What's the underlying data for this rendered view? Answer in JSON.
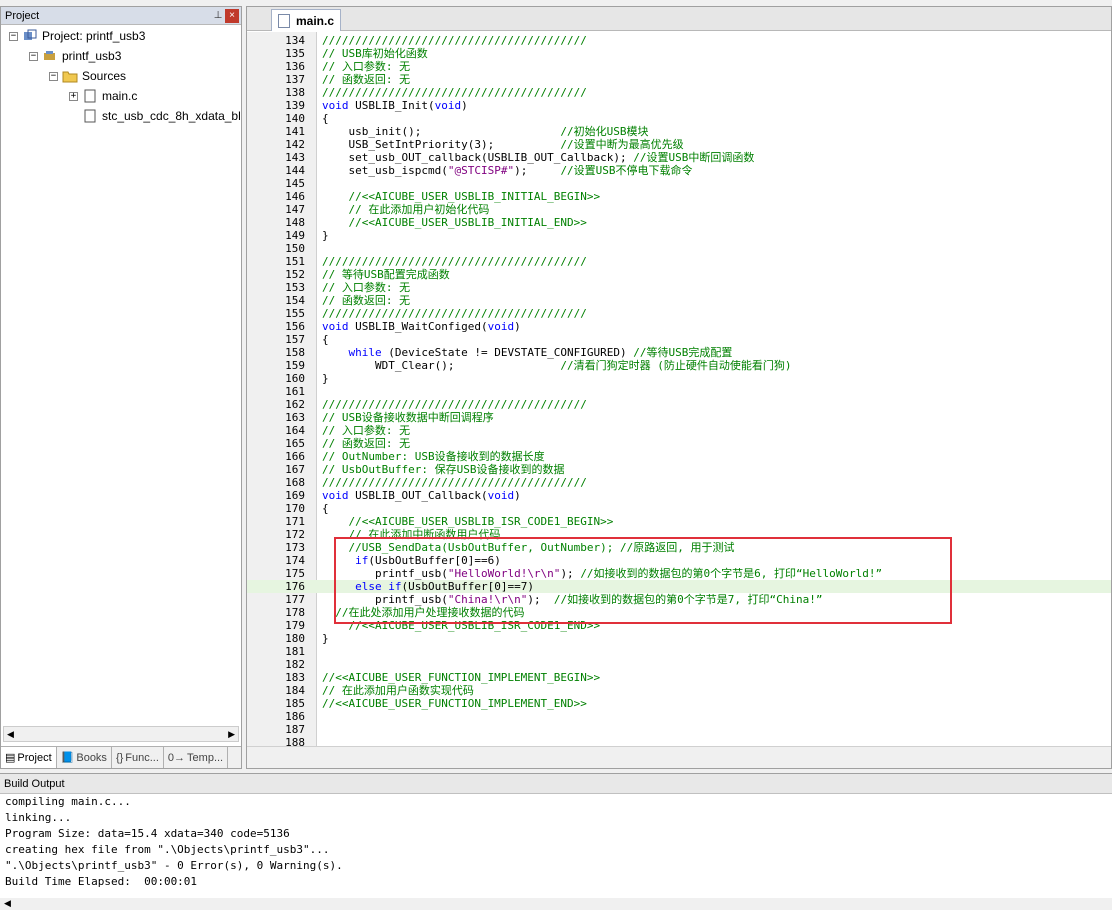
{
  "project": {
    "title": "Project",
    "pin": "⊥",
    "close": "×",
    "tree": {
      "root": "Project: printf_usb3",
      "target": "printf_usb3",
      "group": "Sources",
      "files": [
        "main.c",
        "stc_usb_cdc_8h_xdata_bl"
      ]
    },
    "tabs": [
      "Project",
      "Books",
      "Func...",
      "Temp..."
    ],
    "tab_icons": [
      "project-icon",
      "books-icon",
      "functions-icon",
      "templates-icon"
    ]
  },
  "editor": {
    "tab": "main.c",
    "highlight_color": "#e6f5e0",
    "comment_color": "#008000",
    "keyword_color": "#0000ff",
    "string_color": "#800080",
    "lines": [
      {
        "n": "134",
        "t": "////////////////////////////////////////",
        "c": "cm"
      },
      {
        "n": "135",
        "t": "// USB库初始化函数",
        "c": "cm"
      },
      {
        "n": "136",
        "t": "// 入口参数: 无",
        "c": "cm"
      },
      {
        "n": "137",
        "t": "// 函数返回: 无",
        "c": "cm"
      },
      {
        "n": "138",
        "t": "////////////////////////////////////////",
        "c": "cm"
      },
      {
        "n": "139",
        "t": "void USBLIB_Init(void)",
        "c": ""
      },
      {
        "n": "140",
        "t": "{",
        "c": ""
      },
      {
        "n": "141",
        "t": "    usb_init();                     //初始化USB模块",
        "c": ""
      },
      {
        "n": "142",
        "t": "    USB_SetIntPriority(3);          //设置中断为最高优先级",
        "c": ""
      },
      {
        "n": "143",
        "t": "    set_usb_OUT_callback(USBLIB_OUT_Callback); //设置USB中断回调函数",
        "c": ""
      },
      {
        "n": "144",
        "t": "    set_usb_ispcmd(\"@STCISP#\");     //设置USB不停电下载命令",
        "c": ""
      },
      {
        "n": "145",
        "t": "",
        "c": ""
      },
      {
        "n": "146",
        "t": "    //<<AICUBE_USER_USBLIB_INITIAL_BEGIN>>",
        "c": "cm"
      },
      {
        "n": "147",
        "t": "    // 在此添加用户初始化代码",
        "c": "cm"
      },
      {
        "n": "148",
        "t": "    //<<AICUBE_USER_USBLIB_INITIAL_END>>",
        "c": "cm"
      },
      {
        "n": "149",
        "t": "}",
        "c": ""
      },
      {
        "n": "150",
        "t": "",
        "c": ""
      },
      {
        "n": "151",
        "t": "////////////////////////////////////////",
        "c": "cm"
      },
      {
        "n": "152",
        "t": "// 等待USB配置完成函数",
        "c": "cm"
      },
      {
        "n": "153",
        "t": "// 入口参数: 无",
        "c": "cm"
      },
      {
        "n": "154",
        "t": "// 函数返回: 无",
        "c": "cm"
      },
      {
        "n": "155",
        "t": "////////////////////////////////////////",
        "c": "cm"
      },
      {
        "n": "156",
        "t": "void USBLIB_WaitConfiged(void)",
        "c": ""
      },
      {
        "n": "157",
        "t": "{",
        "c": ""
      },
      {
        "n": "158",
        "t": "    while (DeviceState != DEVSTATE_CONFIGURED) //等待USB完成配置",
        "c": ""
      },
      {
        "n": "159",
        "t": "        WDT_Clear();                //清看门狗定时器 (防止硬件自动使能看门狗)",
        "c": ""
      },
      {
        "n": "160",
        "t": "}",
        "c": ""
      },
      {
        "n": "161",
        "t": "",
        "c": ""
      },
      {
        "n": "162",
        "t": "////////////////////////////////////////",
        "c": "cm"
      },
      {
        "n": "163",
        "t": "// USB设备接收数据中断回调程序",
        "c": "cm"
      },
      {
        "n": "164",
        "t": "// 入口参数: 无",
        "c": "cm"
      },
      {
        "n": "165",
        "t": "// 函数返回: 无",
        "c": "cm"
      },
      {
        "n": "166",
        "t": "// OutNumber: USB设备接收到的数据长度",
        "c": "cm"
      },
      {
        "n": "167",
        "t": "// UsbOutBuffer: 保存USB设备接收到的数据",
        "c": "cm"
      },
      {
        "n": "168",
        "t": "////////////////////////////////////////",
        "c": "cm"
      },
      {
        "n": "169",
        "t": "void USBLIB_OUT_Callback(void)",
        "c": ""
      },
      {
        "n": "170",
        "t": "{",
        "c": ""
      },
      {
        "n": "171",
        "t": "    //<<AICUBE_USER_USBLIB_ISR_CODE1_BEGIN>>",
        "c": "cm"
      },
      {
        "n": "172",
        "t": "    // 在此添加中断函数用户代码",
        "c": "cm"
      },
      {
        "n": "173",
        "t": "    //USB_SendData(UsbOutBuffer, OutNumber); //原路返回, 用于测试",
        "c": "cm"
      },
      {
        "n": "174",
        "t": "     if(UsbOutBuffer[0]==6)",
        "c": ""
      },
      {
        "n": "175",
        "t": "        printf_usb(\"HelloWorld!\\r\\n\"); //如接收到的数据包的第0个字节是6, 打印“HelloWorld!”",
        "c": ""
      },
      {
        "n": "176",
        "t": "     else if(UsbOutBuffer[0]==7)",
        "c": "",
        "hl": true
      },
      {
        "n": "177",
        "t": "        printf_usb(\"China!\\r\\n\");  //如接收到的数据包的第0个字节是7, 打印“China!”",
        "c": ""
      },
      {
        "n": "178",
        "t": "  //在此处添加用户处理接收数据的代码",
        "c": "cm"
      },
      {
        "n": "179",
        "t": "    //<<AICUBE_USER_USBLIB_ISR_CODE1_END>>",
        "c": "cm"
      },
      {
        "n": "180",
        "t": "}",
        "c": ""
      },
      {
        "n": "181",
        "t": "",
        "c": ""
      },
      {
        "n": "182",
        "t": "",
        "c": ""
      },
      {
        "n": "183",
        "t": "//<<AICUBE_USER_FUNCTION_IMPLEMENT_BEGIN>>",
        "c": "cm"
      },
      {
        "n": "184",
        "t": "// 在此添加用户函数实现代码",
        "c": "cm"
      },
      {
        "n": "185",
        "t": "//<<AICUBE_USER_FUNCTION_IMPLEMENT_END>>",
        "c": "cm"
      },
      {
        "n": "186",
        "t": "",
        "c": ""
      },
      {
        "n": "187",
        "t": "",
        "c": ""
      },
      {
        "n": "188",
        "t": "",
        "c": ""
      }
    ]
  },
  "build": {
    "title": "Build Output",
    "lines": [
      "compiling main.c...",
      "linking...",
      "Program Size: data=15.4 xdata=340 code=5136",
      "creating hex file from \".\\Objects\\printf_usb3\"...",
      "\".\\Objects\\printf_usb3\" - 0 Error(s), 0 Warning(s).",
      "Build Time Elapsed:  00:00:01"
    ]
  }
}
